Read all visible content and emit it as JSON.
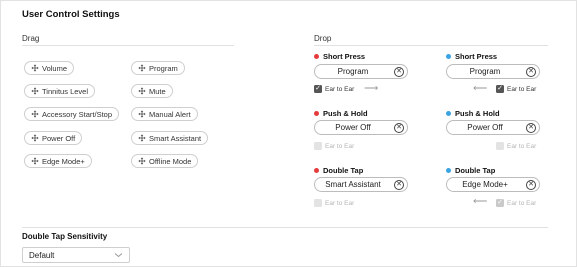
{
  "title": "User Control Settings",
  "drag": {
    "label": "Drag",
    "chips": [
      {
        "label": "Volume",
        "icon": "move-icon"
      },
      {
        "label": "Program",
        "icon": "move-icon"
      },
      {
        "label": "Tinnitus Level",
        "icon": "move-icon"
      },
      {
        "label": "Mute",
        "icon": "move-icon"
      },
      {
        "label": "Accessory Start/Stop",
        "icon": "move-icon"
      },
      {
        "label": "Manual Alert",
        "icon": "move-icon"
      },
      {
        "label": "Power Off",
        "icon": "move-icon"
      },
      {
        "label": "Smart Assistant",
        "icon": "move-icon"
      },
      {
        "label": "Edge Mode+",
        "icon": "move-icon"
      },
      {
        "label": "Offline Mode",
        "icon": "move-icon"
      }
    ]
  },
  "drop": {
    "label": "Drop",
    "colors": {
      "left": "#e53b3b",
      "right": "#3aa3e3"
    },
    "left": [
      {
        "heading": "Short Press",
        "value": "Program",
        "ear_label": "Ear to Ear",
        "ear_checked": true,
        "ear_enabled": true
      },
      {
        "heading": "Push & Hold",
        "value": "Power Off",
        "ear_label": "Ear to Ear",
        "ear_checked": false,
        "ear_enabled": false
      },
      {
        "heading": "Double Tap",
        "value": "Smart Assistant",
        "ear_label": "Ear to Ear",
        "ear_checked": false,
        "ear_enabled": false
      }
    ],
    "right": [
      {
        "heading": "Short Press",
        "value": "Program",
        "ear_label": "Ear to Ear",
        "ear_checked": true,
        "ear_enabled": true
      },
      {
        "heading": "Push & Hold",
        "value": "Power Off",
        "ear_label": "Ear to Ear",
        "ear_checked": false,
        "ear_enabled": false
      },
      {
        "heading": "Double Tap",
        "value": "Edge Mode+",
        "ear_label": "Ear to Ear",
        "ear_checked": true,
        "ear_enabled": false
      }
    ],
    "arrows": {
      "right": "⟶",
      "left": "⟵"
    }
  },
  "sensitivity": {
    "label": "Double Tap Sensitivity",
    "value": "Default"
  }
}
